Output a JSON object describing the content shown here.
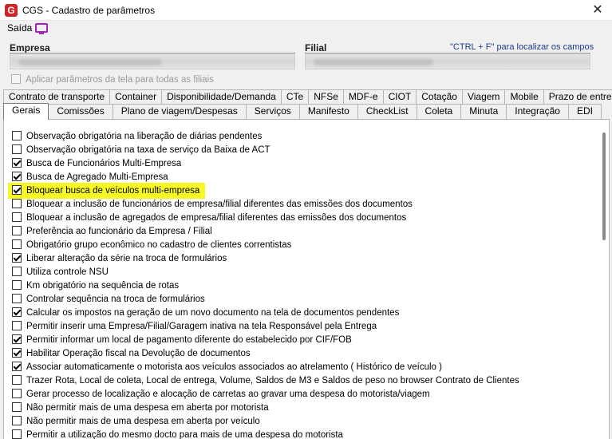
{
  "window": {
    "title": "CGS - Cadastro de parâmetros",
    "close_glyph": "✕",
    "logo_letter": "G"
  },
  "menu": {
    "saida_label": "Saída"
  },
  "fields": {
    "empresa_label": "Empresa",
    "filial_label": "Filial",
    "hint": "\"CTRL + F\" para localizar os campos"
  },
  "apply_all": {
    "label": "Aplicar parâmetros da tela para todas as filiais",
    "checked": false,
    "disabled": true
  },
  "tabs_row1": [
    {
      "label": "Contrato de transporte"
    },
    {
      "label": "Container"
    },
    {
      "label": "Disponibilidade/Demanda"
    },
    {
      "label": "CTe"
    },
    {
      "label": "NFSe"
    },
    {
      "label": "MDF-e"
    },
    {
      "label": "CIOT"
    },
    {
      "label": "Cotação"
    },
    {
      "label": "Viagem"
    },
    {
      "label": "Mobile"
    },
    {
      "label": "Prazo de entrega"
    }
  ],
  "tabs_row2": [
    {
      "label": "Gerais",
      "active": true
    },
    {
      "label": "Comissões"
    },
    {
      "label": "Plano de viagem/Despesas"
    },
    {
      "label": "Serviços"
    },
    {
      "label": "Manifesto"
    },
    {
      "label": "CheckList"
    },
    {
      "label": "Coleta"
    },
    {
      "label": "Minuta"
    },
    {
      "label": "Integração"
    },
    {
      "label": "EDI"
    }
  ],
  "options": [
    {
      "label": "Observação obrigatória na liberação de diárias pendentes",
      "checked": false
    },
    {
      "label": "Observação obrigatória na taxa de serviço da Baixa de ACT",
      "checked": false
    },
    {
      "label": "Busca de Funcionários Multi-Empresa",
      "checked": true
    },
    {
      "label": "Busca de Agregado Multi-Empresa",
      "checked": true
    },
    {
      "label": "Bloquear busca de veículos multi-empresa",
      "checked": true,
      "highlighted": true
    },
    {
      "label": "Bloquear a inclusão de funcionários de empresa/filial diferentes das emissões dos documentos",
      "checked": false
    },
    {
      "label": "Bloquear a inclusão de agregados de empresa/filial diferentes das emissões dos documentos",
      "checked": false
    },
    {
      "label": "Preferência ao funcionário da Empresa / Filial",
      "checked": false
    },
    {
      "label": "Obrigatório grupo econômico no cadastro de clientes correntistas",
      "checked": false
    },
    {
      "label": "Liberar alteração da série na troca de formulários",
      "checked": true
    },
    {
      "label": "Utiliza controle NSU",
      "checked": false
    },
    {
      "label": "Km obrigatório na sequência de rotas",
      "checked": false
    },
    {
      "label": "Controlar sequência na troca de formulários",
      "checked": false
    },
    {
      "label": "Calcular os impostos na geração de um novo documento na tela de documentos pendentes",
      "checked": true
    },
    {
      "label": "Permitir inserir uma Empresa/Filial/Garagem inativa na tela Responsável pela Entrega",
      "checked": false
    },
    {
      "label": "Permitir informar um local de pagamento diferente do estabelecido por CIF/FOB",
      "checked": true
    },
    {
      "label": "Habilitar Operação fiscal na Devolução de documentos",
      "checked": true
    },
    {
      "label": "Associar automaticamente o motorista aos veículos associados ao atrelamento ( Histórico de veículo )",
      "checked": true
    },
    {
      "label": "Trazer Rota, Local de coleta, Local de entrega, Volume, Saldos de M3 e Saldos de peso no browser Contrato de Clientes",
      "checked": false
    },
    {
      "label": "Gerar processo de localização e alocação de carretas ao gravar uma despesa do motorista/viagem",
      "checked": false
    },
    {
      "label": "Não permitir mais de uma despesa em aberta por motorista",
      "checked": false
    },
    {
      "label": "Não permitir mais de uma despesa em aberta por veículo",
      "checked": false
    },
    {
      "label": "Permitir a utilização do mesmo docto para mais de uma despesa do motorista",
      "checked": false
    }
  ]
}
